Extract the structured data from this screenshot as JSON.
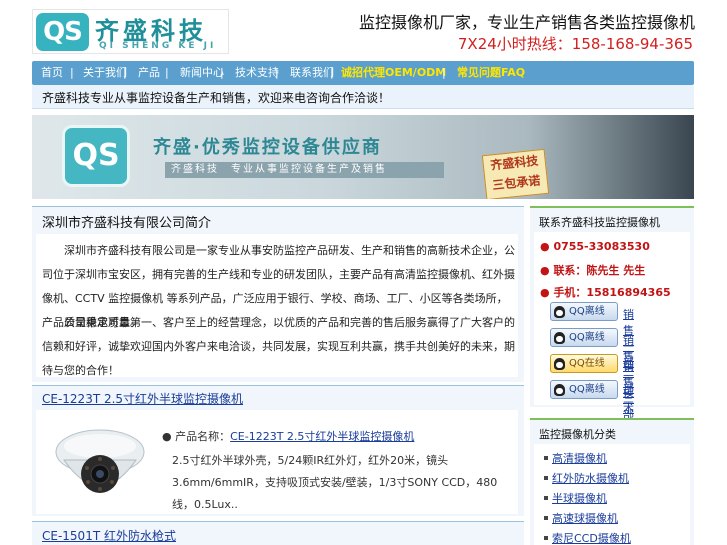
{
  "header": {
    "logo_mark": "QS",
    "logo_cn": "齐盛科技",
    "logo_pinyin": "QI SHENG KE JI",
    "slogan": "监控摄像机厂家，专业生产销售各类监控摄像机",
    "hotline": "7X24小时热线：158-168-94-365"
  },
  "nav": {
    "items": [
      "首页",
      "关于我们",
      "产品",
      "新闻中心",
      "技术支持",
      "联系我们"
    ],
    "highlight_items": [
      "诚招代理OEM/ODM",
      "常见问题FAQ"
    ],
    "separator": "|"
  },
  "notice": {
    "text": "齐盛科技专业从事监控设备生产和销售，欢迎来电咨询合作洽谈！"
  },
  "banner": {
    "mark": "QS",
    "tagline": "齐盛·优秀监控设备供应商",
    "subline": "齐盛科技　专业从事监控设备生产及销售",
    "card_line1": "齐盛科技",
    "card_line2": "三包承诺"
  },
  "about": {
    "title": "深圳市齐盛科技有限公司简介",
    "para1": "深圳市齐盛科技有限公司是一家专业从事安防监控产品研发、生产和销售的高新技术企业，公司位于深圳市宝安区，拥有完善的生产线和专业的研发团队，主要产品有高清监控摄像机、红外摄像机、CCTV 监控摄像机 等系列产品，广泛应用于银行、学校、商场、工厂、小区等各类场所，产品质量稳定可靠。",
    "para2": "公司秉承质量第一、客户至上的经营理念，以优质的产品和完善的售后服务赢得了广大客户的信赖和好评，诚挚欢迎国内外客户来电洽谈，共同发展，实现互利共赢，携手共创美好的未来，期待与您的合作！"
  },
  "products": [
    {
      "title": "CE-1223T 2.5寸红外半球监控摄像机",
      "name_label": "产品名称：",
      "name": "CE-1223T 2.5寸红外半球监控摄像机",
      "desc": "2.5寸红外半球外壳，5/24颗IR红外灯，红外20米，镜头3.6mm/6mmIR，支持吸顶式安装/壁装，1/3寸SONY CCD，480线，0.5Lux.."
    },
    {
      "title": "CE-1501T 红外防水枪式"
    }
  ],
  "contact": {
    "title": "联系齐盛科技监控摄像机",
    "phone": "0755-33083530",
    "contact_person": "联系：陈先生 先生",
    "mobile": "手机：15816894365",
    "qq": [
      {
        "status": "QQ离线",
        "online": false,
        "label": "销售一部"
      },
      {
        "status": "QQ离线",
        "online": false,
        "label": "销售二部"
      },
      {
        "status": "QQ在线",
        "online": true,
        "label": "销售三部"
      },
      {
        "status": "QQ离线",
        "online": false,
        "label": "技术支持"
      }
    ]
  },
  "categories": {
    "title": "监控摄像机分类",
    "items": [
      "高清摄像机",
      "红外防水摄像机",
      "半球摄像机",
      "高速球摄像机",
      "索尼CCD摄像机"
    ]
  },
  "colors": {
    "nav_bg": "#5a9fce",
    "nav_highlight": "#ffe600",
    "hotline": "#d21f1f",
    "brand_teal": "#37b3bf",
    "sidebar_accent": "#7fbf5a"
  }
}
